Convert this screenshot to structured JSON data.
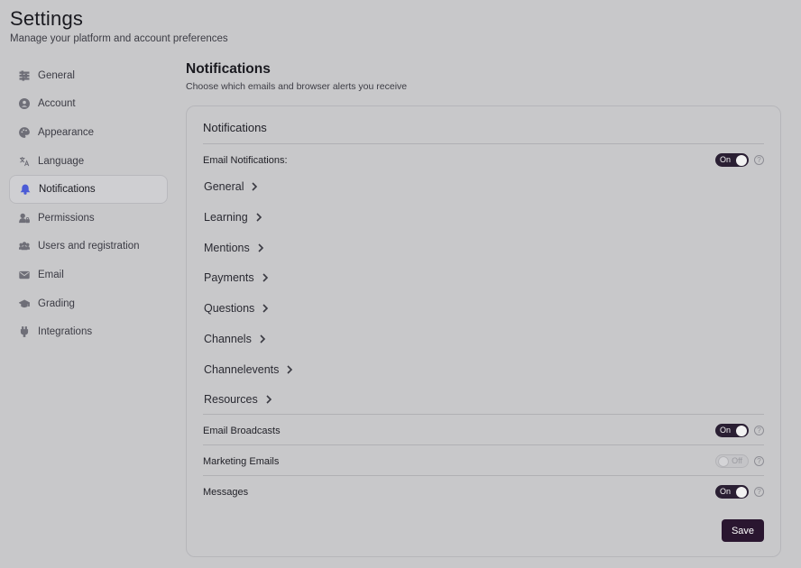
{
  "header": {
    "title": "Settings",
    "subtitle": "Manage your platform and account preferences"
  },
  "sidebar": {
    "items": [
      {
        "label": "General",
        "icon": "sliders-icon"
      },
      {
        "label": "Account",
        "icon": "user-circle-icon"
      },
      {
        "label": "Appearance",
        "icon": "palette-icon"
      },
      {
        "label": "Language",
        "icon": "translate-icon"
      },
      {
        "label": "Notifications",
        "icon": "bell-icon",
        "active": true
      },
      {
        "label": "Permissions",
        "icon": "user-lock-icon"
      },
      {
        "label": "Users and registration",
        "icon": "users-icon"
      },
      {
        "label": "Email",
        "icon": "envelope-icon"
      },
      {
        "label": "Grading",
        "icon": "graduation-cap-icon"
      },
      {
        "label": "Integrations",
        "icon": "plug-icon"
      }
    ]
  },
  "main": {
    "title": "Notifications",
    "subtitle": "Choose which emails and browser alerts you receive",
    "card": {
      "title": "Notifications",
      "email_notifications": {
        "label": "Email Notifications:",
        "state": "On"
      },
      "categories": [
        "General",
        "Learning",
        "Mentions",
        "Payments",
        "Questions",
        "Channels",
        "Channelevents",
        "Resources"
      ],
      "email_broadcasts": {
        "label": "Email Broadcasts",
        "state": "On"
      },
      "marketing_emails": {
        "label": "Marketing Emails",
        "state": "Off"
      },
      "messages": {
        "label": "Messages",
        "state": "On"
      },
      "help_glyph": "?",
      "save_label": "Save"
    }
  },
  "colors": {
    "background": "#c8c8ca",
    "toggle_on": "#2a1f33",
    "save_button": "#2a1630",
    "active_icon": "#4b5bd6",
    "highlight": "#ffffff"
  }
}
